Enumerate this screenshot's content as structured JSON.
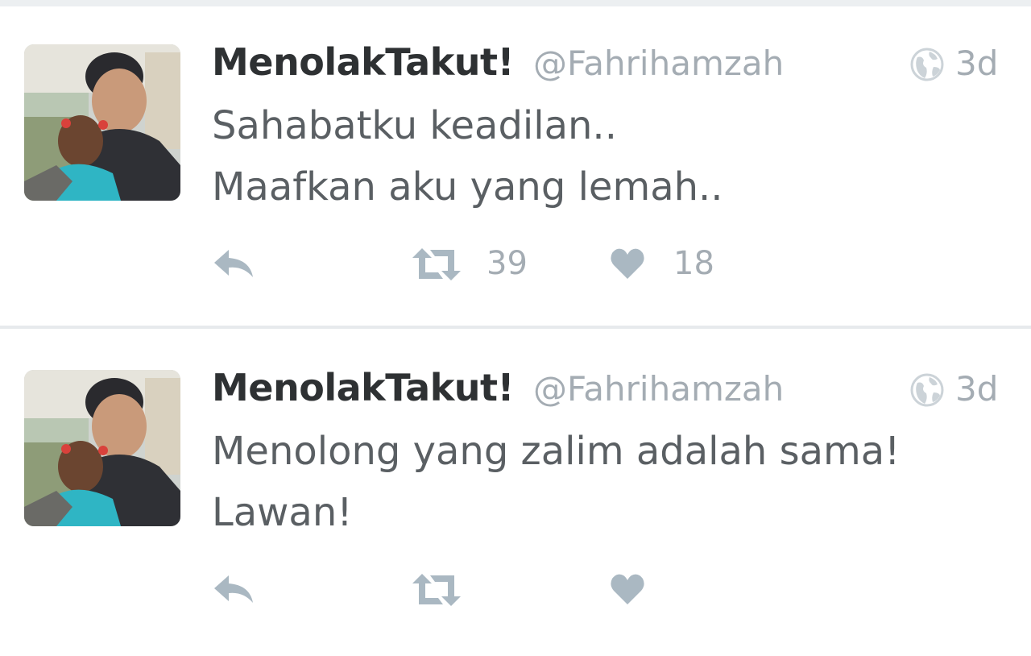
{
  "tweets": [
    {
      "display_name": "MenolakTakut!",
      "handle": "@Fahrihamzah",
      "timestamp": "3d",
      "text_lines": [
        "Sahabatku keadilan..",
        "Maafkan aku yang lemah.."
      ],
      "retweet_count": "39",
      "like_count": "18"
    },
    {
      "display_name": "MenolakTakut!",
      "handle": "@Fahrihamzah",
      "timestamp": "3d",
      "text_lines": [
        "Menolong yang zalim adalah sama!",
        "Lawan!"
      ],
      "retweet_count": "",
      "like_count": ""
    }
  ],
  "icons": {
    "reply": "reply-icon",
    "retweet": "retweet-icon",
    "like": "heart-icon",
    "visibility": "globe-icon"
  },
  "colors": {
    "name_text": "#2e3133",
    "meta_text": "#a4acb3",
    "tweet_text": "#5a5f63",
    "icon": "#aab8c2",
    "divider": "#e7eaed"
  }
}
